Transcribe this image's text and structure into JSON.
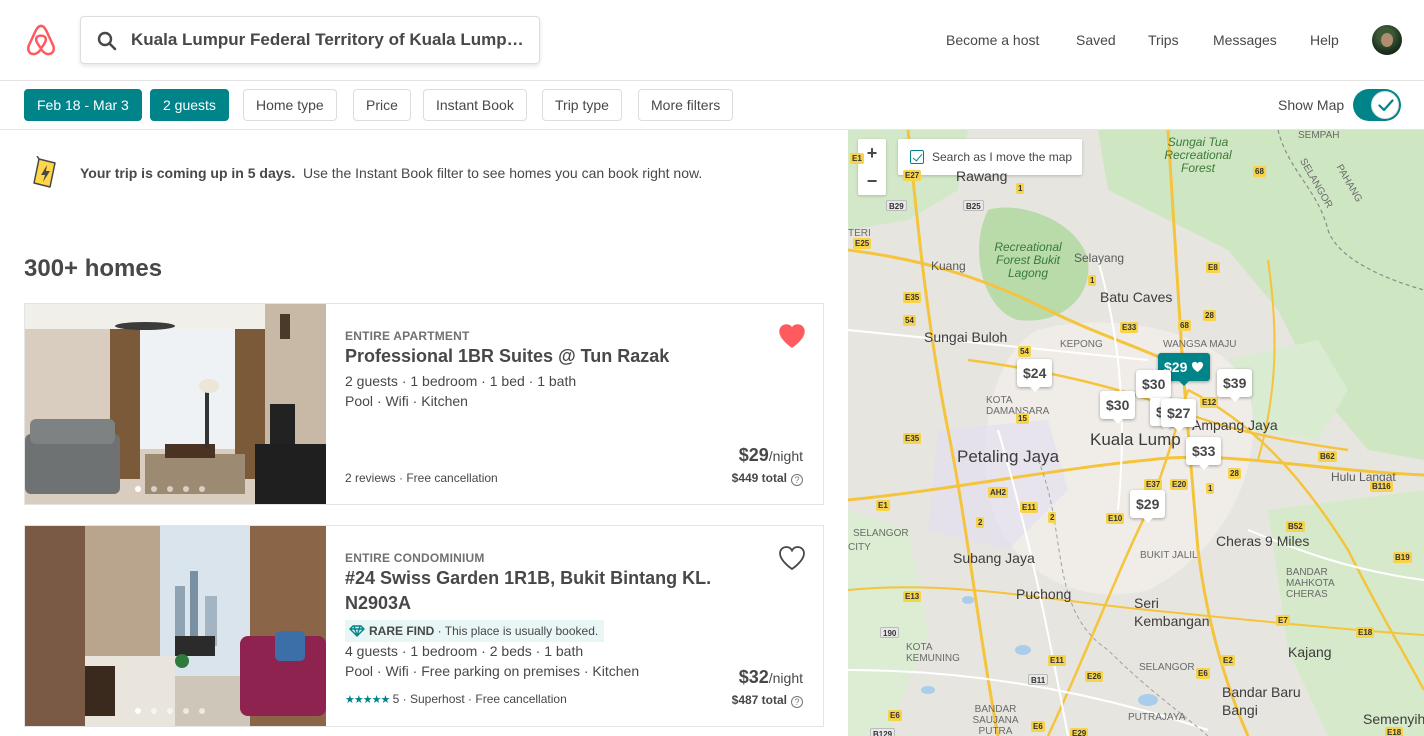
{
  "search": {
    "value": "Kuala Lumpur Federal Territory of Kuala Lumpur ..."
  },
  "nav": {
    "become_host": "Become a host",
    "saved": "Saved",
    "trips": "Trips",
    "messages": "Messages",
    "help": "Help"
  },
  "filters": {
    "dates": "Feb 18 - Mar 3",
    "guests": "2 guests",
    "home_type": "Home type",
    "price": "Price",
    "instant_book": "Instant Book",
    "trip_type": "Trip type",
    "more_filters": "More filters",
    "show_map": "Show Map",
    "show_map_on": true
  },
  "notice": {
    "bold": "Your trip is coming up in 5 days.",
    "text": "Use the Instant Book filter to see homes you can book right now."
  },
  "results_count": "300+ homes",
  "listings": [
    {
      "type": "ENTIRE APARTMENT",
      "title": "Professional 1BR Suites @ Tun Razak",
      "details": "2 guests · 1 bedroom · 1 bed · 1 bath",
      "amenities": "Pool · Wifi · Kitchen",
      "footer": "2 reviews · Free cancellation",
      "price": "$29",
      "per": "/night",
      "total": "$449 total",
      "saved": true,
      "photo_count": 5,
      "photo_index": 0
    },
    {
      "type": "ENTIRE CONDOMINIUM",
      "title": "#24 Swiss Garden 1R1B, Bukit Bintang KL. N2903A",
      "rare_label": "RARE FIND",
      "rare_text": " · This place is usually booked.",
      "details": "4 guests · 1 bedroom · 2 beds · 1 bath",
      "amenities": "Pool · Wifi · Free parking on premises · Kitchen",
      "stars": "★★★★★",
      "footer": "5 · Superhost · Free cancellation",
      "price": "$32",
      "per": "/night",
      "total": "$487 total",
      "saved": false,
      "photo_count": 5,
      "photo_index": 0
    }
  ],
  "map": {
    "zoom_in": "+",
    "zoom_out": "−",
    "search_move": "Search as I move the map",
    "search_move_checked": true,
    "pins": [
      "$24",
      "$29",
      "$30",
      "$39",
      "$30",
      "$27",
      "$33",
      "$29",
      "$"
    ],
    "labels": {
      "kuala_lumpur": "Kuala Lump",
      "petaling_jaya": "Petaling Jaya",
      "ampang_jaya": "Ampang Jaya",
      "batu_caves": "Batu Caves",
      "subang_jaya": "Subang Jaya",
      "cheras": "Cheras 9 Miles",
      "puchong": "Puchong",
      "seri_kembangan": "Seri Kembangan",
      "kajang": "Kajang",
      "bandar_baru_bangi": "Bandar Baru Bangi",
      "sungai_buloh": "Sungai Buloh",
      "rawang": "Rawang",
      "kuang": "Kuang",
      "selayang": "Selayang",
      "kepong": "KEPONG",
      "wangsa_maju": "WANGSA MAJU",
      "kota_damansara": "KOTA DAMANSARA",
      "hulu_langat": "Hulu Langat",
      "bandar_mahkota": "BANDAR MAHKOTA CHERAS",
      "semenyih": "Semenyih",
      "kota_kemuning": "KOTA KEMUNING",
      "bandar_saujana": "BANDAR SAUJANA PUTRA",
      "putrajaya": "PUTRAJAYA",
      "bukit_jalil": "BUKIT JALIL",
      "selangor1": "SELANGOR",
      "selangor2": "SELANGOR",
      "selangor3": "SELANGOR",
      "recreational": "Recreational Forest Bukit Lagong",
      "sungai_tua": "Sungai Tua Recreational Forest",
      "pahang": "PAHANG",
      "sempah": "SEMPAH",
      "city": "CITY",
      "teri": "TERI"
    }
  },
  "colors": {
    "brand": "#FF5A5F",
    "accent": "#008489",
    "heart": "#FF5A5F"
  }
}
